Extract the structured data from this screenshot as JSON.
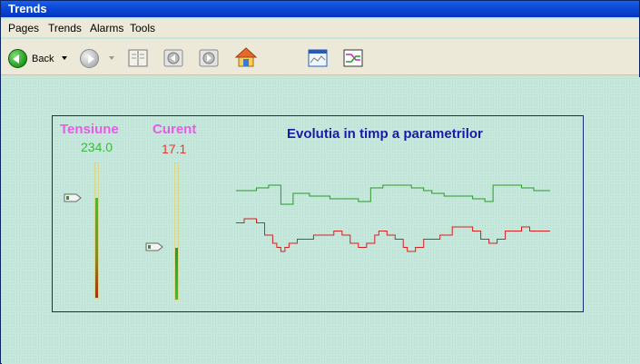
{
  "window": {
    "title": "Trends"
  },
  "menu": [
    "Pages",
    "Trends",
    "Alarms",
    "Tools"
  ],
  "toolbar": {
    "back_label": "Back"
  },
  "panel": {
    "chart_title": "Evolutia in timp a parametrilor",
    "tensiune": {
      "label": "Tensiune",
      "value": "234.0",
      "level": 0.74,
      "label_color": "#e65ce6",
      "value_color": "#3db83d"
    },
    "curent": {
      "label": "Curent",
      "value": "17.1",
      "level": 0.38,
      "label_color": "#e65ce6",
      "value_color": "#e23a3a"
    }
  },
  "chart_data": {
    "type": "line",
    "series": [
      {
        "color": "#2a9a2a",
        "values": [
          7,
          7,
          7,
          7,
          7,
          8,
          8,
          8,
          9,
          9,
          9,
          2,
          2,
          2,
          6,
          6,
          6,
          6,
          5,
          5,
          5,
          5,
          5,
          4,
          4,
          4,
          4,
          4,
          4,
          4,
          3,
          3,
          3,
          8,
          8,
          8,
          9,
          9,
          9,
          9,
          9,
          9,
          9,
          8,
          8,
          8,
          7,
          7,
          6,
          6,
          6,
          5,
          5,
          5,
          5,
          5,
          5,
          5,
          4,
          4,
          4,
          3,
          3,
          9,
          9,
          9,
          9,
          9,
          9,
          9,
          8,
          8,
          8,
          7,
          7,
          7,
          7,
          7
        ]
      },
      {
        "color": "#d42020",
        "values": [
          9,
          9,
          10,
          10,
          10,
          9,
          9,
          6,
          6,
          4,
          3,
          2,
          3,
          4,
          4,
          5,
          5,
          5,
          5,
          6,
          6,
          6,
          6,
          6,
          7,
          7,
          6,
          6,
          4,
          4,
          3,
          3,
          4,
          4,
          6,
          7,
          7,
          6,
          6,
          5,
          5,
          3,
          2,
          2,
          3,
          3,
          5,
          5,
          5,
          5,
          6,
          6,
          6,
          8,
          8,
          8,
          8,
          8,
          7,
          7,
          5,
          5,
          4,
          4,
          5,
          5,
          7,
          7,
          7,
          7,
          8,
          8,
          7,
          7,
          7,
          7,
          7,
          7
        ]
      }
    ]
  }
}
